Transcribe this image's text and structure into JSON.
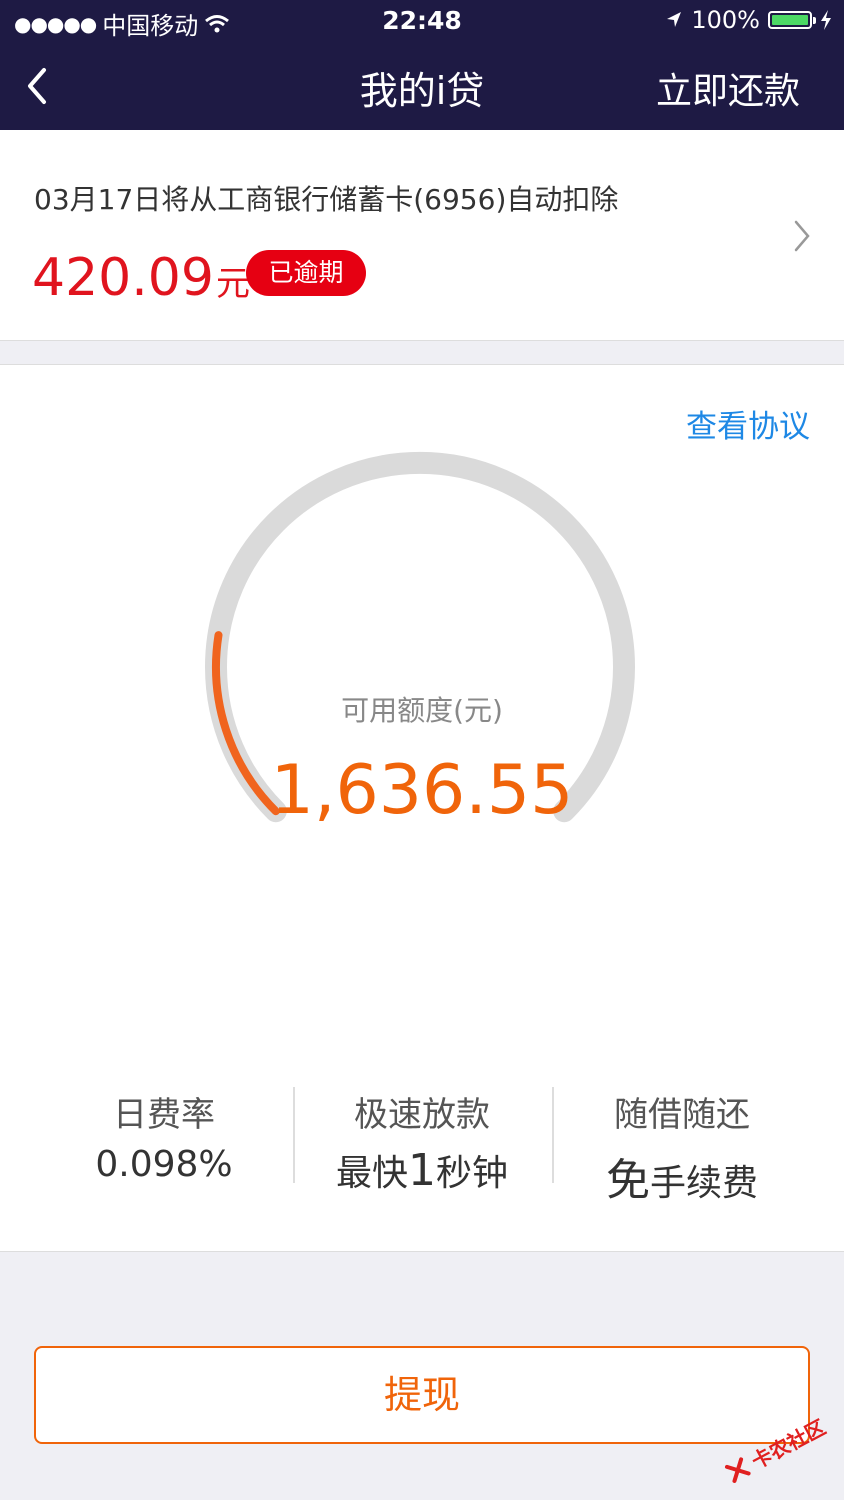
{
  "status_bar": {
    "carrier": "中国移动",
    "time": "22:48",
    "battery": "100%"
  },
  "nav": {
    "title": "我的i贷",
    "action": "立即还款"
  },
  "bill": {
    "description": "03月17日将从工商银行储蓄卡(6956)自动扣除",
    "amount": "420.09",
    "unit": "元",
    "badge": "已逾期"
  },
  "credit": {
    "agreement_link": "查看协议",
    "label": "可用额度(元)",
    "value": "1,636.55",
    "progress_fraction": 0.2,
    "colors": {
      "track": "#dadada",
      "progress": "#f0641e"
    }
  },
  "features": [
    {
      "title": "日费率",
      "value": "0.098%"
    },
    {
      "title": "极速放款",
      "value_prefix": "最快",
      "value_big": "1",
      "value_suffix": "秒钟"
    },
    {
      "title": "随借随还",
      "value_big": "免",
      "value_suffix": "手续费"
    }
  ],
  "withdraw_button": "提现",
  "watermark": "卡农社区",
  "colors": {
    "header_bg": "#1e1a44",
    "accent": "#f0640a",
    "danger": "#e60012",
    "link": "#1e88e5"
  }
}
